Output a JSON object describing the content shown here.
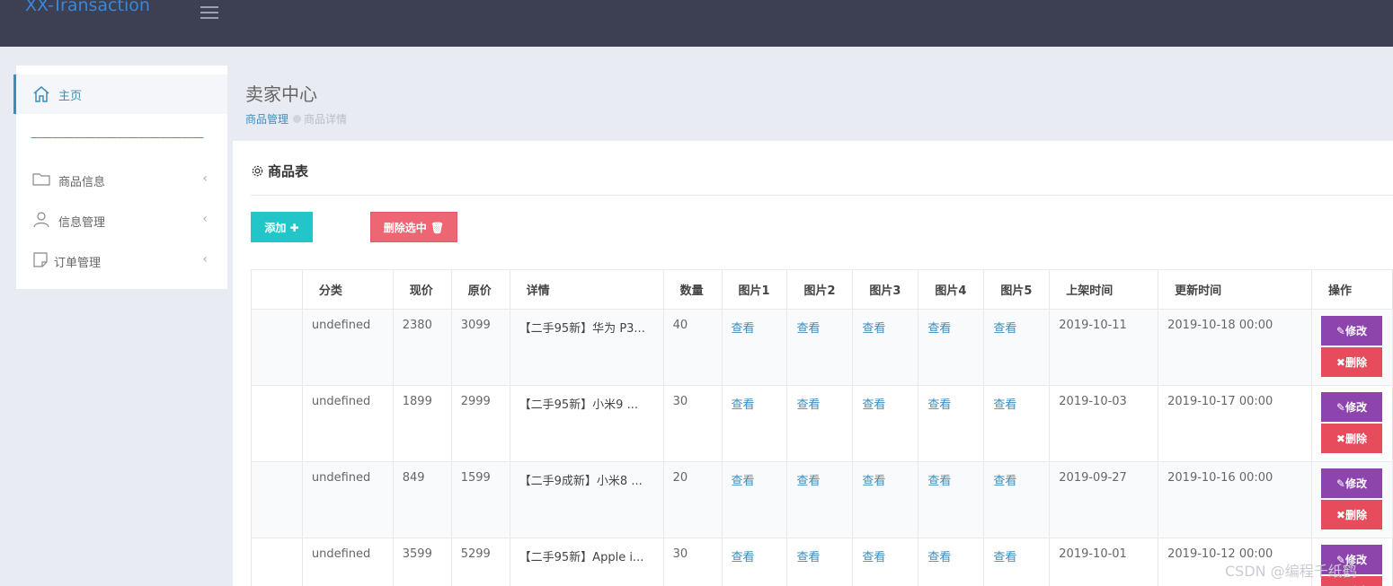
{
  "app": {
    "brand": "XX-Transaction"
  },
  "sidebar": {
    "home": "主页",
    "divider": "————————————————",
    "items": [
      {
        "label": "商品信息",
        "icon": "folder-icon"
      },
      {
        "label": "信息管理",
        "icon": "user-icon"
      },
      {
        "label": "订单管理",
        "icon": "note-icon"
      }
    ]
  },
  "header": {
    "title": "卖家中心",
    "breadcrumb": [
      "商品管理",
      "商品详情"
    ]
  },
  "panel": {
    "title": "商品表",
    "add_button": "添加 ✚",
    "delete_selected_button": "删除选中 🗑"
  },
  "table": {
    "columns": [
      "",
      "分类",
      "现价",
      "原价",
      "详情",
      "数量",
      "图片1",
      "图片2",
      "图片3",
      "图片4",
      "图片5",
      "上架时间",
      "更新时间",
      "操作"
    ],
    "view_label": "查看",
    "edit_label": "修改",
    "delete_label": "删除",
    "rows": [
      {
        "category": "undefined",
        "price": "2380",
        "orig_price": "3099",
        "detail": "【二手95新】华为 P3...",
        "qty": "40",
        "listed": "2019-10-11",
        "updated": "2019-10-18 00:00"
      },
      {
        "category": "undefined",
        "price": "1899",
        "orig_price": "2999",
        "detail": "【二手95新】小米9 ...",
        "qty": "30",
        "listed": "2019-10-03",
        "updated": "2019-10-17 00:00"
      },
      {
        "category": "undefined",
        "price": "849",
        "orig_price": "1599",
        "detail": "【二手9成新】小米8 ...",
        "qty": "20",
        "listed": "2019-09-27",
        "updated": "2019-10-16 00:00"
      },
      {
        "category": "undefined",
        "price": "3599",
        "orig_price": "5299",
        "detail": "【二手95新】Apple i...",
        "qty": "30",
        "listed": "2019-10-01",
        "updated": "2019-10-12 00:00"
      }
    ]
  },
  "watermark": "CSDN @编程千纸鹤",
  "colors": {
    "topbar": "#3d4053",
    "accent": "#3c8dbc",
    "add": "#23c6c8",
    "danger": "#ed5565",
    "edit": "#8e44ad"
  }
}
